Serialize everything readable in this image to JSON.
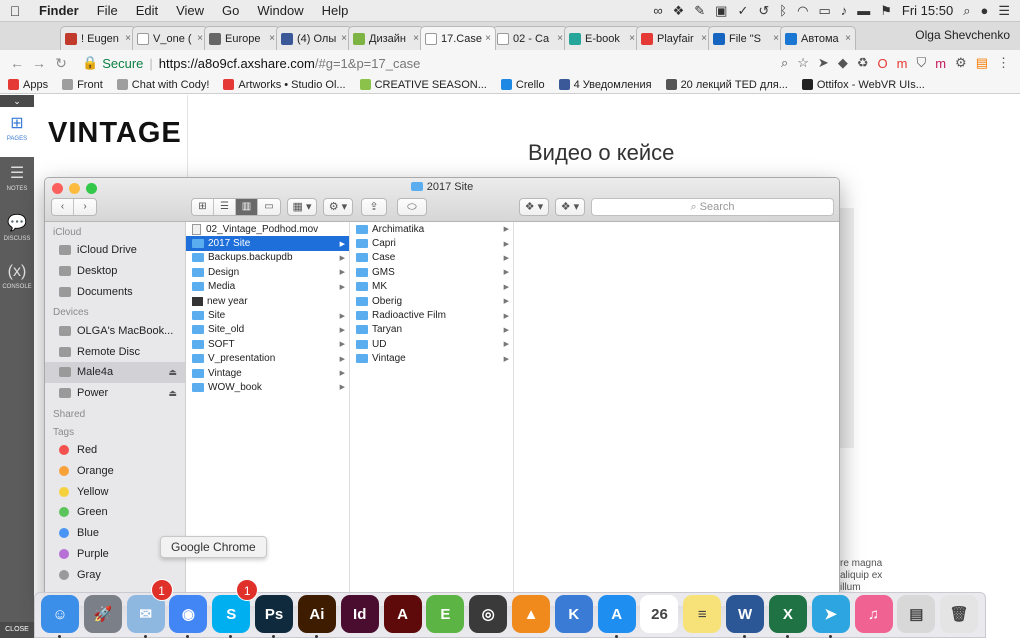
{
  "menubar": {
    "app_name": "Finder",
    "menus": [
      "File",
      "Edit",
      "View",
      "Go",
      "Window",
      "Help"
    ],
    "clock": "Fri 15:50"
  },
  "browser": {
    "tabs": [
      {
        "label": "! Eugen",
        "color": "#c0392b"
      },
      {
        "label": "V_one (",
        "color": "#ffffff"
      },
      {
        "label": "Europe",
        "color": "#666666"
      },
      {
        "label": "(4) Олы",
        "color": "#3b5998"
      },
      {
        "label": "Дизайн",
        "color": "#7cb342"
      },
      {
        "label": "17.Case",
        "color": "#ffffff"
      },
      {
        "label": "02 - Ca",
        "color": "#ffffff"
      },
      {
        "label": "E-book",
        "color": "#26a69a"
      },
      {
        "label": "Playfair",
        "color": "#e53935"
      },
      {
        "label": "File \"S",
        "color": "#1565c0"
      },
      {
        "label": "Автома",
        "color": "#1976d2"
      }
    ],
    "active_tab_index": 5,
    "profile_name": "Olga Shevchenko",
    "omnibox": {
      "secure_label": "Secure",
      "host": "https://a8o9cf.axshare.com",
      "path": "/#g=1&p=17_case"
    },
    "bookmarks": [
      {
        "label": "Apps",
        "color": "#e53935"
      },
      {
        "label": "Front",
        "color": "#9e9e9e"
      },
      {
        "label": "Chat with Cody!",
        "color": "#9e9e9e"
      },
      {
        "label": "Artworks • Studio Ol...",
        "color": "#e53935"
      },
      {
        "label": "CREATIVE SEASON...",
        "color": "#8bc34a"
      },
      {
        "label": "Crello",
        "color": "#1e88e5"
      },
      {
        "label": "4 Уведомления",
        "color": "#3b5998"
      },
      {
        "label": "20 лекций TED для...",
        "color": "#555555"
      },
      {
        "label": "Ottifox - WebVR UIs...",
        "color": "#222222"
      }
    ]
  },
  "axure": {
    "sidebar_items": [
      {
        "label": "PAGES",
        "glyph": "⊞"
      },
      {
        "label": "NOTES",
        "glyph": "☰"
      },
      {
        "label": "DISCUSS",
        "glyph": "💬"
      },
      {
        "label": "CONSOLE",
        "glyph": "(x)"
      }
    ],
    "close_label": "CLOSE",
    "logo_text": "VINTAGE",
    "video_title": "Видео о кейсе",
    "lorem_lines": [
      "re magna",
      "aliquip ex",
      "illum"
    ]
  },
  "finder": {
    "title": "2017 Site",
    "search_placeholder": "Search",
    "sidebar": {
      "sections": [
        {
          "title": "iCloud",
          "items": [
            {
              "label": "iCloud Drive",
              "eject": false
            },
            {
              "label": "Desktop",
              "eject": false
            },
            {
              "label": "Documents",
              "eject": false
            }
          ]
        },
        {
          "title": "Devices",
          "items": [
            {
              "label": "OLGA's MacBook...",
              "eject": false
            },
            {
              "label": "Remote Disc",
              "eject": false
            },
            {
              "label": "Male4a",
              "eject": true,
              "selected": true
            },
            {
              "label": "Power",
              "eject": true
            }
          ]
        },
        {
          "title": "Shared",
          "items": []
        },
        {
          "title": "Tags",
          "items": []
        }
      ],
      "tags": [
        {
          "label": "Red",
          "color": "#f2514e"
        },
        {
          "label": "Orange",
          "color": "#f7a13a"
        },
        {
          "label": "Yellow",
          "color": "#f6d13e"
        },
        {
          "label": "Green",
          "color": "#5cc45c"
        },
        {
          "label": "Blue",
          "color": "#4a94f5"
        },
        {
          "label": "Purple",
          "color": "#b771d6"
        },
        {
          "label": "Gray",
          "color": "#9a9a9a"
        }
      ]
    },
    "column1": [
      {
        "label": "02_Vintage_Podhod.mov",
        "kind": "file",
        "arrow": false
      },
      {
        "label": "2017 Site",
        "kind": "folder",
        "arrow": true,
        "selected": true
      },
      {
        "label": "Backups.backupdb",
        "kind": "folder",
        "arrow": true
      },
      {
        "label": "Design",
        "kind": "folder",
        "arrow": true
      },
      {
        "label": "Media",
        "kind": "folder",
        "arrow": true
      },
      {
        "label": "new year",
        "kind": "dark",
        "arrow": false
      },
      {
        "label": "Site",
        "kind": "folder",
        "arrow": true
      },
      {
        "label": "Site_old",
        "kind": "folder",
        "arrow": true
      },
      {
        "label": "SOFT",
        "kind": "folder",
        "arrow": true
      },
      {
        "label": "V_presentation",
        "kind": "folder",
        "arrow": true
      },
      {
        "label": "Vintage",
        "kind": "folder",
        "arrow": true
      },
      {
        "label": "WOW_book",
        "kind": "folder",
        "arrow": true
      }
    ],
    "column2": [
      {
        "label": "Archimatika",
        "kind": "folder",
        "arrow": true
      },
      {
        "label": "Capri",
        "kind": "folder",
        "arrow": true
      },
      {
        "label": "Case",
        "kind": "folder",
        "arrow": true
      },
      {
        "label": "GMS",
        "kind": "folder",
        "arrow": true
      },
      {
        "label": "MK",
        "kind": "folder",
        "arrow": true
      },
      {
        "label": "Oberig",
        "kind": "folder",
        "arrow": true
      },
      {
        "label": "Radioactive Film",
        "kind": "folder",
        "arrow": true
      },
      {
        "label": "Taryan",
        "kind": "folder",
        "arrow": true
      },
      {
        "label": "UD",
        "kind": "folder",
        "arrow": true
      },
      {
        "label": "Vintage",
        "kind": "folder",
        "arrow": true
      }
    ]
  },
  "tooltip": "Google Chrome",
  "dock": [
    {
      "name": "finder-icon",
      "text": "☺",
      "color": "#3b8fe8",
      "running": true
    },
    {
      "name": "launchpad-icon",
      "text": "🚀",
      "color": "#7a7f88",
      "running": false
    },
    {
      "name": "mail-icon",
      "text": "✉",
      "color": "#8fb8e0",
      "badge": "1",
      "running": true
    },
    {
      "name": "chrome-icon",
      "text": "◉",
      "color": "#4285f4",
      "running": true
    },
    {
      "name": "skype-icon",
      "text": "S",
      "color": "#00aff0",
      "badge": "1",
      "running": true
    },
    {
      "name": "photoshop-icon",
      "text": "Ps",
      "color": "#0f2a3c",
      "running": true
    },
    {
      "name": "illustrator-icon",
      "text": "Ai",
      "color": "#3d1c00",
      "running": true
    },
    {
      "name": "indesign-icon",
      "text": "Id",
      "color": "#4a0d2f",
      "running": false
    },
    {
      "name": "acrobat-icon",
      "text": "A",
      "color": "#5e0a0a",
      "running": false
    },
    {
      "name": "evernote-icon",
      "text": "E",
      "color": "#5bb443",
      "running": false
    },
    {
      "name": "dvd-player-icon",
      "text": "◎",
      "color": "#3a3a3a",
      "running": false
    },
    {
      "name": "vlc-icon",
      "text": "▲",
      "color": "#f08a1c",
      "running": false
    },
    {
      "name": "keynote-icon",
      "text": "K",
      "color": "#3a7bd5",
      "running": false
    },
    {
      "name": "app-store-icon",
      "text": "A",
      "color": "#1f8ef1",
      "running": true
    },
    {
      "name": "calendar-icon",
      "text": "26",
      "color": "#ffffff",
      "running": false
    },
    {
      "name": "notes-icon",
      "text": "≡",
      "color": "#f7e27a",
      "running": false
    },
    {
      "name": "word-icon",
      "text": "W",
      "color": "#2b5797",
      "running": true
    },
    {
      "name": "excel-icon",
      "text": "X",
      "color": "#1f7244",
      "running": true
    },
    {
      "name": "telegram-icon",
      "text": "➤",
      "color": "#2ca5e0",
      "running": true
    },
    {
      "name": "itunes-icon",
      "text": "♫",
      "color": "#f06292",
      "running": false
    },
    {
      "name": "preview-icon",
      "text": "▤",
      "color": "#d8d8d8",
      "running": false
    },
    {
      "name": "trash-icon",
      "text": "🗑",
      "color": "#e4e4e4",
      "running": false
    }
  ]
}
